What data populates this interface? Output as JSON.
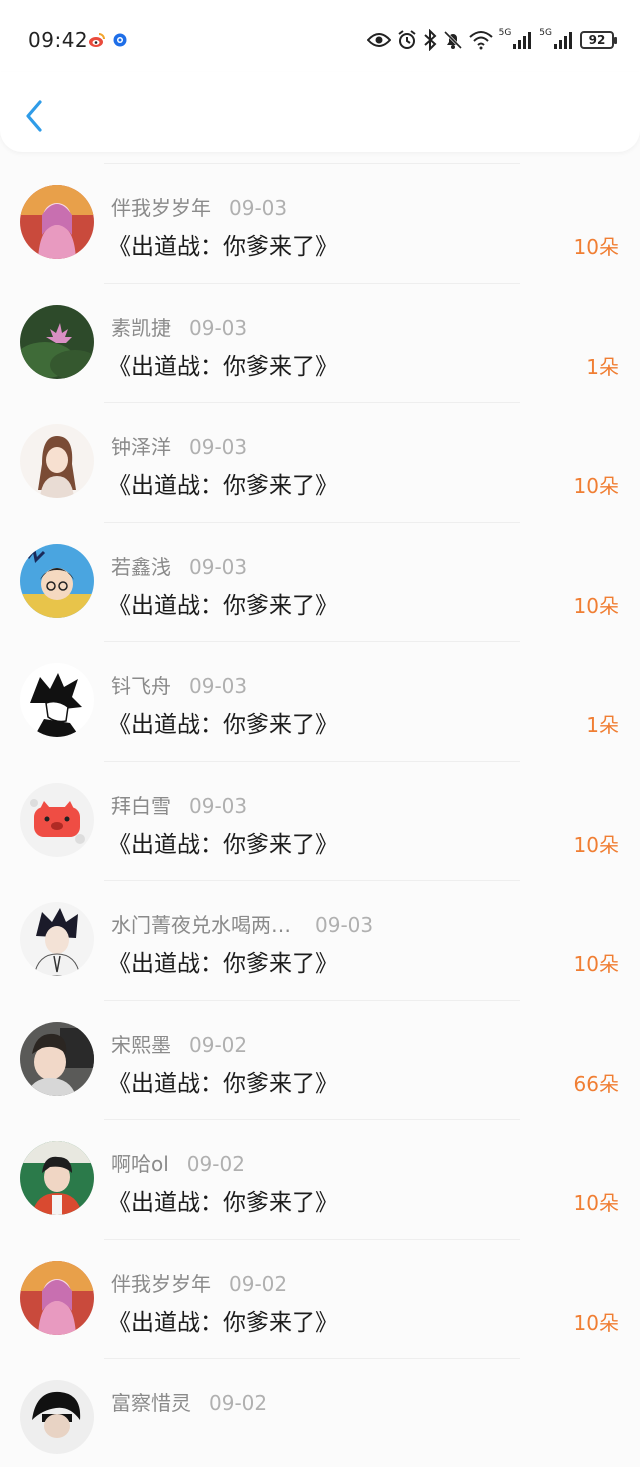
{
  "status_bar": {
    "time": "09:42",
    "network_1": "5G",
    "network_2": "5G",
    "battery": "92"
  },
  "nav": {
    "back_icon": "chevron-left-icon"
  },
  "colors": {
    "accent": "#2f9ce8",
    "flower_count": "#f07e33",
    "name": "#8a8a8a",
    "date": "#b0b0b0"
  },
  "list": [
    {
      "name": "伴我岁岁年",
      "date": "09-03",
      "title": "《出道战：你爹来了》",
      "flowers": "10朵"
    },
    {
      "name": "素凯捷",
      "date": "09-03",
      "title": "《出道战：你爹来了》",
      "flowers": "1朵"
    },
    {
      "name": "钟泽洋",
      "date": "09-03",
      "title": "《出道战：你爹来了》",
      "flowers": "10朵"
    },
    {
      "name": "若鑫浅",
      "date": "09-03",
      "title": "《出道战：你爹来了》",
      "flowers": "10朵"
    },
    {
      "name": "钭飞舟",
      "date": "09-03",
      "title": "《出道战：你爹来了》",
      "flowers": "1朵"
    },
    {
      "name": "拜白雪",
      "date": "09-03",
      "title": "《出道战：你爹来了》",
      "flowers": "10朵"
    },
    {
      "name": "水门菁夜兑水喝两…",
      "date": "09-03",
      "title": "《出道战：你爹来了》",
      "flowers": "10朵"
    },
    {
      "name": "宋熙墨",
      "date": "09-02",
      "title": "《出道战：你爹来了》",
      "flowers": "66朵"
    },
    {
      "name": "啊哈ol",
      "date": "09-02",
      "title": "《出道战：你爹来了》",
      "flowers": "10朵"
    },
    {
      "name": "伴我岁岁年",
      "date": "09-02",
      "title": "《出道战：你爹来了》",
      "flowers": "10朵"
    },
    {
      "name": "富察惜灵",
      "date": "09-02",
      "title": "",
      "flowers": ""
    }
  ]
}
